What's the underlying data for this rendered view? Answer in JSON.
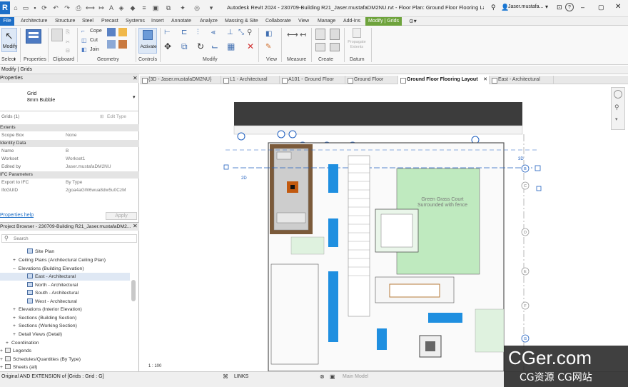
{
  "titlebar": {
    "app_logo": "R",
    "title": "Autodesk Revit 2024 - 230709-Building R21_Jaser.mustafaDM2NU.rvt - Floor Plan: Ground Floor Flooring Layout",
    "user": "Jaser.mustafa...",
    "help": "?"
  },
  "ribbon_tabs": [
    "File",
    "Architecture",
    "Structure",
    "Steel",
    "Precast",
    "Systems",
    "Insert",
    "Annotate",
    "Analyze",
    "Massing & Site",
    "Collaborate",
    "View",
    "Manage",
    "Add-Ins",
    "Modify | Grids"
  ],
  "ribbon": {
    "modify_label": "Modify",
    "select_label": "Select",
    "properties_label": "Properties",
    "clipboard_label": "Clipboard",
    "geometry_label": "Geometry",
    "controls_label": "Controls",
    "modify_panel_label": "Modify",
    "view_label": "View",
    "measure_label": "Measure",
    "create_label": "Create",
    "datum_label": "Datum",
    "cope_label": "Cope",
    "cut_label": "Cut",
    "join_label": "Join",
    "activate_label": "Activate",
    "propagate_label": "Propagate Extents"
  },
  "context_bar": "Modify | Grids",
  "view_tabs": [
    "{3D - Jaser.mustafaDM2NU}",
    "L1 - Architectural",
    "A101 - Ground Floor",
    "Ground Floor",
    "Ground Floor Flooring Layout",
    "East - Architectural"
  ],
  "properties": {
    "header": "Properties",
    "type_name": "Grid",
    "type_sub": "8mm Bubble",
    "instance_count": "Grids (1)",
    "edit_type": "Edit Type",
    "sections": {
      "extents": "Extents",
      "identity": "Identity Data",
      "ifc": "IFC Parameters"
    },
    "rows": {
      "scope_box_k": "Scope Box",
      "scope_box_v": "None",
      "name_k": "Name",
      "name_v": "B",
      "workset_k": "Workset",
      "workset_v": "Workset1",
      "edited_by_k": "Edited by",
      "edited_by_v": "Jaser.mustafaDM2NU",
      "export_ifc_k": "Export to IFC",
      "export_ifc_v": "By Type",
      "ifcguid_k": "IfcGUID",
      "ifcguid_v": "2goa4aGW6wua8dw5u0CzM"
    },
    "help_link": "Properties help",
    "apply": "Apply"
  },
  "browser": {
    "header": "Project Browser - 230709-Building R21_Jaser.mustafaDM2...",
    "search_placeholder": "Search",
    "items": [
      "Site Plan",
      "Ceiling Plans (Architectural Ceiling Plan)",
      "Elevations (Building Elevation)",
      "East - Architectural",
      "North - Architectural",
      "South - Architectural",
      "West - Architectural",
      "Elevations (Interior Elevation)",
      "Sections (Building Section)",
      "Sections (Working Section)",
      "Detail Views (Detail)",
      "Coordination",
      "Legends",
      "Schedules/Quantities (By Type)",
      "Sheets (all)"
    ]
  },
  "drawing": {
    "courtyard_line1": "Green Grass Court",
    "courtyard_line2": "Surrounded with fence",
    "label_2d_left": "2D",
    "label_3d_right": "3D",
    "grid_bubbles": [
      "B",
      "C",
      "D",
      "E",
      "F",
      "G"
    ],
    "scale": "1 : 100"
  },
  "status": {
    "left_text": "Original AND EXTENSION  of [Grids : Grid : G]",
    "links": "LINKS",
    "model": "Main Model"
  },
  "watermark": {
    "brand": "CGer.com",
    "sub": "CG资源  CG网站"
  }
}
